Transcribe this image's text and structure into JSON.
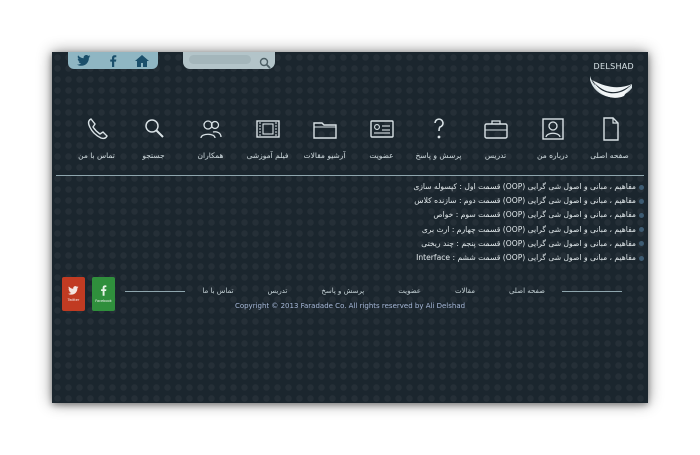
{
  "search": {
    "placeholder": ""
  },
  "logo": {
    "text": "DELSHAD"
  },
  "nav": {
    "items": [
      {
        "label": "صفحه اصلی",
        "icon": "document-icon"
      },
      {
        "label": "درباره من",
        "icon": "portrait-icon"
      },
      {
        "label": "تدریس",
        "icon": "briefcase-icon"
      },
      {
        "label": "پرسش و پاسخ",
        "icon": "question-icon"
      },
      {
        "label": "عضویت",
        "icon": "id-card-icon"
      },
      {
        "label": "آرشیو مقالات",
        "icon": "folder-icon"
      },
      {
        "label": "فیلم آموزشی",
        "icon": "film-icon"
      },
      {
        "label": "همکاران",
        "icon": "users-icon"
      },
      {
        "label": "جستجو",
        "icon": "search-icon"
      },
      {
        "label": "تماس با من",
        "icon": "phone-icon"
      }
    ]
  },
  "articles": [
    "مفاهیم ، مبانی و اصول شی گرایی (OOP) قسمت اول : کپسوله سازی",
    "مفاهیم ، مبانی و اصول شی گرایی (OOP) قسمت دوم : سازنده کلاس",
    "مفاهیم ، مبانی و اصول شی گرایی (OOP) قسمت سوم : خواص",
    "مفاهیم ، مبانی و اصول شی گرایی (OOP) قسمت چهارم : ارث بری",
    "مفاهیم ، مبانی و اصول شی گرایی (OOP) قسمت پنجم : چند ریختی",
    "مفاهیم ، مبانی و اصول شی گرایی (OOP) قسمت ششم : Interface"
  ],
  "footer": {
    "links": [
      "صفحه اصلی",
      "مقالات",
      "عضویت",
      "پرسش و پاسخ",
      "تدریس",
      "تماس با ما"
    ],
    "copyright": "Copyright © 2013 Faradade Co. All rights reserved by Ali Delshad",
    "twitter_label": "Twitter",
    "facebook_label": "Facebook"
  },
  "colors": {
    "background": "#1b262e",
    "twitter_tile": "#c13b22",
    "facebook_tile": "#2f8f3c",
    "social_bar": "#8fb6c3"
  }
}
